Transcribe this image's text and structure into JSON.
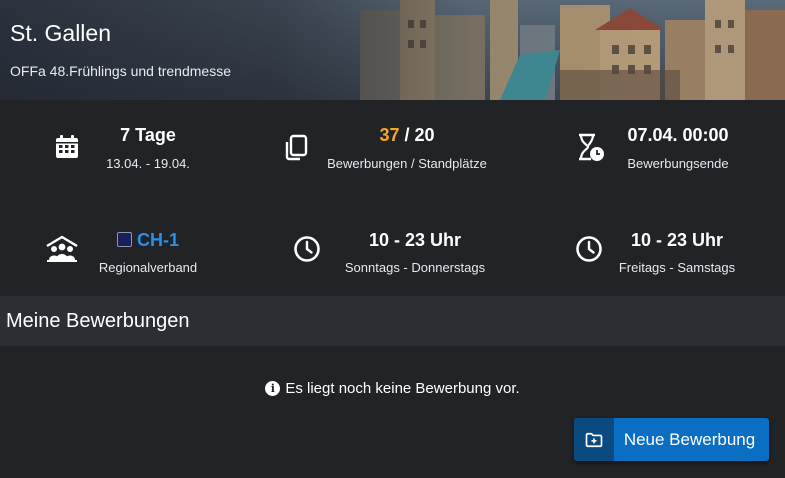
{
  "header": {
    "title": "St. Gallen",
    "subtitle": "OFFa 48.Frühlings und trendmesse"
  },
  "info": {
    "duration": {
      "value": "7 Tage",
      "label": "13.04. - 19.04.",
      "icon": "calendar-icon"
    },
    "applications": {
      "current": "37",
      "separator": " / ",
      "total": "20",
      "label": "Bewerbungen / Standplätze",
      "icon": "copy-icon"
    },
    "deadline": {
      "value": "07.04. 00:00",
      "label": "Bewerbungsende",
      "icon": "hourglass-clock-icon"
    },
    "region": {
      "value": "CH-1",
      "label": "Regionalverband",
      "icon": "association-icon"
    },
    "hours_weekday": {
      "value": "10 - 23 Uhr",
      "label": "Sonntags - Donnerstags",
      "icon": "clock-icon"
    },
    "hours_weekend": {
      "value": "10 - 23 Uhr",
      "label": "Freitags - Samstags",
      "icon": "clock-icon"
    }
  },
  "section": {
    "title": "Meine Bewerbungen",
    "empty_message": "Es liegt noch keine Bewerbung vor.",
    "new_button_label": "Neue Bewerbung"
  },
  "colors": {
    "background": "#212327",
    "section_header": "#2c2e33",
    "accent_orange": "#f5a623",
    "accent_blue": "#2d8fe6",
    "button": "#0a6ec2"
  }
}
